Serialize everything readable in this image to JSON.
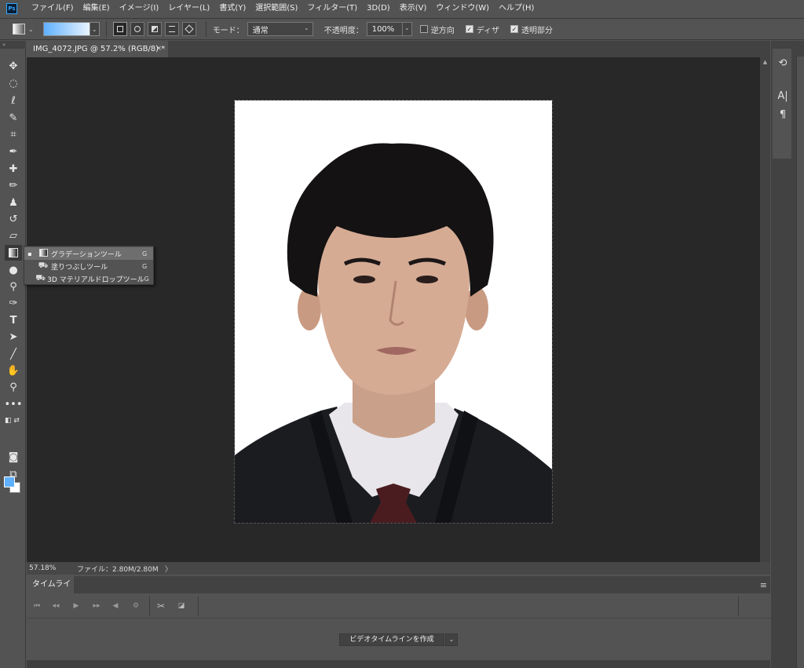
{
  "app": {
    "logo_text": "Ps"
  },
  "menu": [
    "ファイル(F)",
    "編集(E)",
    "イメージ(I)",
    "レイヤー(L)",
    "書式(Y)",
    "選択範囲(S)",
    "フィルター(T)",
    "3D(D)",
    "表示(V)",
    "ウィンドウ(W)",
    "ヘルプ(H)"
  ],
  "options": {
    "mode_label": "モード：",
    "mode_value": "通常",
    "opacity_label": "不透明度：",
    "opacity_value": "100%",
    "reverse_label": "逆方向",
    "reverse_checked": false,
    "dither_label": "ディザ",
    "dither_checked": true,
    "transparency_label": "透明部分",
    "transparency_checked": true,
    "gradient_colors": [
      "#5fb0ff",
      "#e8f4ff"
    ]
  },
  "document": {
    "tab_title": "IMG_4072.JPG @ 57.2% (RGB/8) *",
    "close_glyph": "×"
  },
  "status": {
    "zoom": "57.18%",
    "file_info": "ファイル：2.80M/2.80M",
    "arrow": "〉"
  },
  "tool_flyout": {
    "items": [
      {
        "label": "グラデーションツール",
        "key": "G",
        "selected": true,
        "icon": "gradient-icon"
      },
      {
        "label": "塗りつぶしツール",
        "key": "G",
        "selected": false,
        "icon": "paint-bucket-icon"
      },
      {
        "label": "3D マテリアルドロップツール",
        "key": "G",
        "selected": false,
        "icon": "3d-material-drop-icon"
      }
    ]
  },
  "colors": {
    "foreground": "#5fb0ff",
    "background": "#ffffff",
    "canvas_bg": "#282828",
    "ui_bg": "#535353"
  },
  "timeline": {
    "tab_label": "タイムライン",
    "create_button": "ビデオタイムラインを作成"
  }
}
